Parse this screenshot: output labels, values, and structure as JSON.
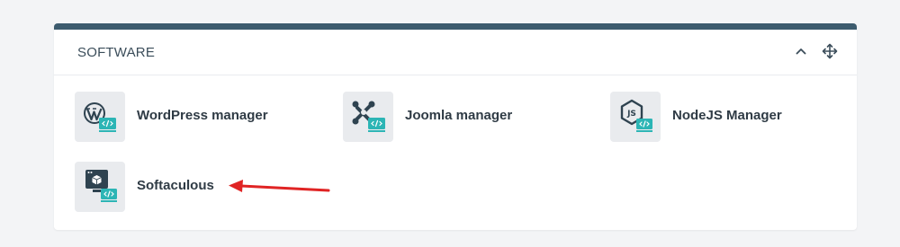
{
  "panel": {
    "title": "SOFTWARE",
    "accent_color": "#3c5b6e",
    "header_icons": [
      "chevron-up-icon",
      "move-icon"
    ]
  },
  "items": [
    {
      "label": "WordPress manager",
      "icon": "wordpress-icon"
    },
    {
      "label": "Joomla manager",
      "icon": "joomla-icon"
    },
    {
      "label": "NodeJS Manager",
      "icon": "nodejs-icon"
    },
    {
      "label": "Softaculous",
      "icon": "softaculous-icon"
    }
  ],
  "badge_color": "#2cb5b5",
  "annotation": {
    "type": "red-arrow",
    "color": "#e02424",
    "points_to": "Softaculous"
  }
}
